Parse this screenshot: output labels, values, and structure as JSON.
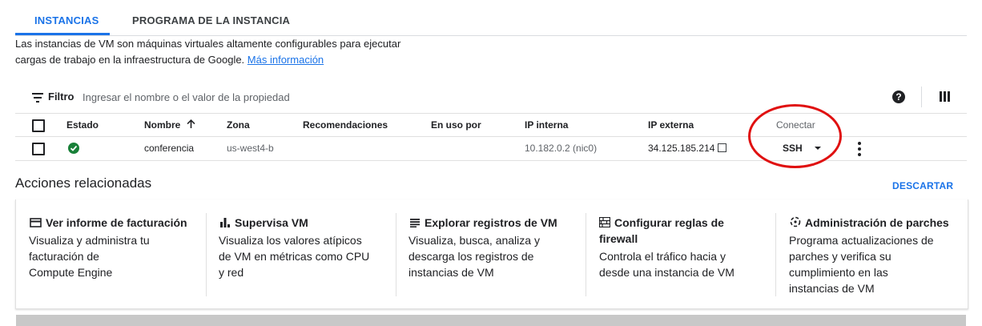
{
  "tabs": [
    {
      "label": "INSTANCIAS",
      "active": true
    },
    {
      "label": "PROGRAMA DE LA INSTANCIA",
      "active": false
    }
  ],
  "description": {
    "line1": "Las instancias de VM son máquinas virtuales altamente configurables para ejecutar",
    "line2": "cargas de trabajo en la infraestructura de Google.",
    "link": "Más información"
  },
  "filter": {
    "label": "Filtro",
    "placeholder": "Ingresar el nombre o el valor de la propiedad"
  },
  "toolbar": {
    "help_icon": "?"
  },
  "table": {
    "headers": {
      "estado": "Estado",
      "nombre": "Nombre",
      "zona": "Zona",
      "recomendaciones": "Recomendaciones",
      "en_uso_por": "En uso por",
      "ip_interna": "IP interna",
      "ip_externa": "IP externa",
      "conectar": "Conectar"
    },
    "rows": [
      {
        "status": "running",
        "nombre": "conferencia",
        "zona": "us-west4-b",
        "recomendaciones": "",
        "en_uso_por": "",
        "ip_interna": "10.182.0.2 (nic0)",
        "ip_externa": "34.125.185.214",
        "conectar": "SSH"
      }
    ]
  },
  "related": {
    "title": "Acciones relacionadas",
    "dismiss": "DESCARTAR",
    "cards": [
      {
        "icon": "billing-card-icon",
        "title": "Ver informe de facturación",
        "body1": "Visualiza y administra tu",
        "body2": "facturación de",
        "body3": "Compute Engine"
      },
      {
        "icon": "bar-chart-icon",
        "title": "Supervisa VM",
        "body1": "Visualiza los valores atípicos",
        "body2": "de VM en métricas como CPU",
        "body3": "y red"
      },
      {
        "icon": "logs-list-icon",
        "title": "Explorar registros de VM",
        "body1": "Visualiza, busca, analiza y",
        "body2": "descarga los registros de",
        "body3": "instancias de VM"
      },
      {
        "icon": "firewall-icon",
        "title1": "Configurar reglas de",
        "title2": "firewall",
        "body1": "Controla el tráfico hacia y",
        "body2": "desde una instancia de VM"
      },
      {
        "icon": "patch-icon",
        "title": "Administración de parches",
        "body1": "Programa actualizaciones de",
        "body2": "parches y verifica su",
        "body3": "cumplimiento en las",
        "body4": "instancias de VM"
      }
    ]
  },
  "colors": {
    "accent": "#1a73e8",
    "status_ok": "#188038",
    "annotation": "#e01010"
  }
}
